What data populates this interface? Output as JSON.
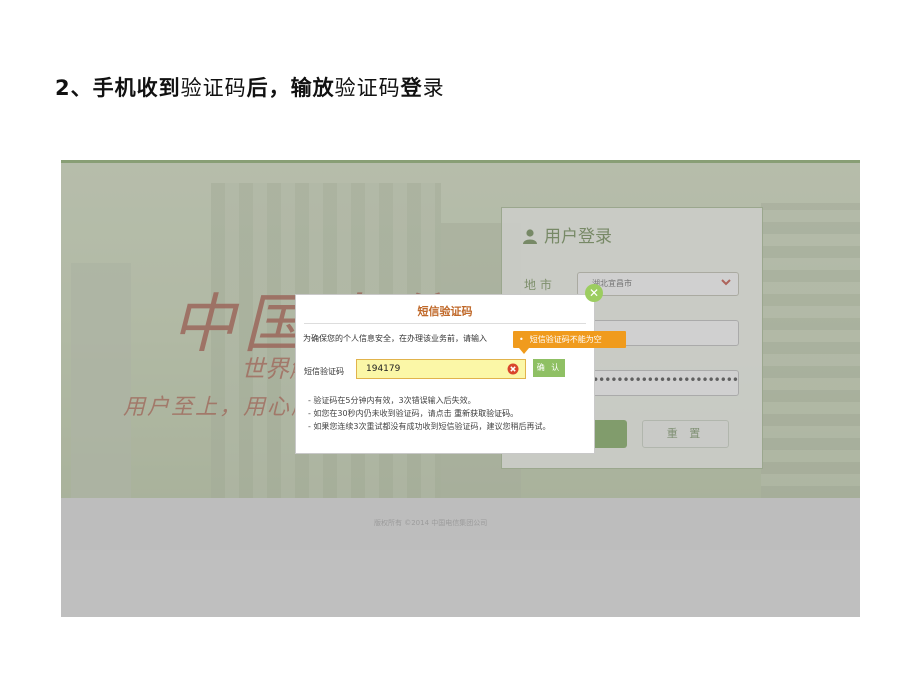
{
  "heading": {
    "num": "2、",
    "part1": "手机收到",
    "part2": "验证码",
    "part3": "后，",
    "part4": "输",
    "part5": "放",
    "part6": "验证码",
    "part7": "登",
    "part8": "录"
  },
  "background": {
    "brand_main": "中国电信",
    "brand_tagline": "世界触手可及",
    "brand_slogan": "用户至上，用心服务"
  },
  "login_panel": {
    "title": "用户登录",
    "city_label": "地  市",
    "city_value": "湖北宜昌市",
    "password_dots": "••••••••••••••••••••••••••••",
    "reset_label": "重 置"
  },
  "footer": {
    "copyright": "版权所有 ©2014 中国电信集团公司"
  },
  "sms_modal": {
    "title": "短信验证码",
    "intro": "为确保您的个人信息安全，在办理该业务前，请输入",
    "code_label": "短信验证码",
    "code_value": "194179",
    "confirm_label": "确 认",
    "tooltip": "短信验证码不能为空",
    "notes": [
      "- 验证码在5分钟内有效，3次错误输入后失效。",
      "- 如您在30秒内仍未收到验证码，请点击",
      "- 如果您连续3次重试都没有成功收到短信验证码，建议您稍后再试。"
    ],
    "resend_link": "重新获取验证码。"
  },
  "colors": {
    "accent_green": "#8fc064",
    "title_orange": "#c0692a",
    "tooltip_orange": "#f09b1d",
    "input_yellow": "#fbf7a7"
  }
}
